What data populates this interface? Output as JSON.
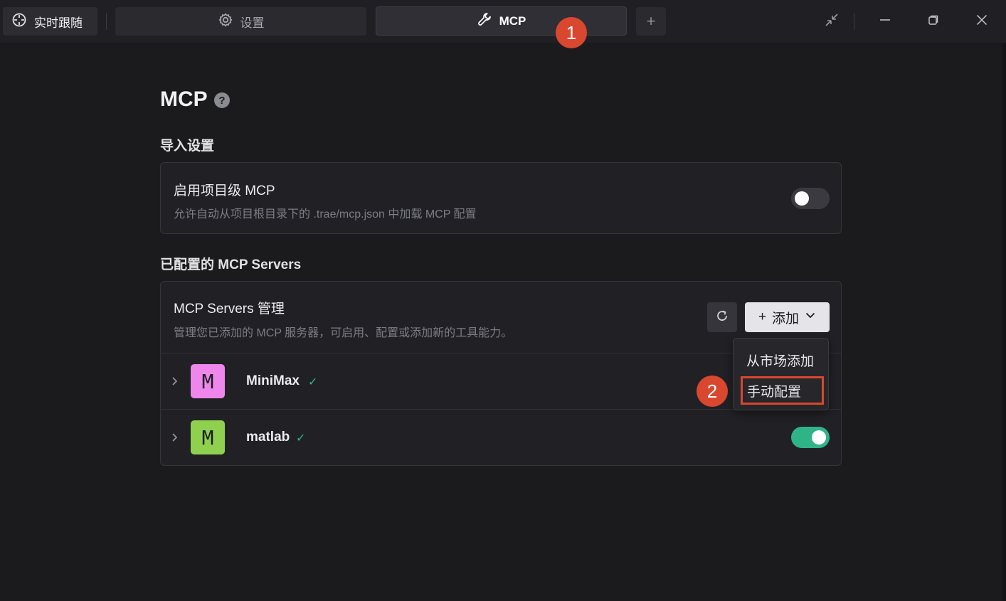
{
  "topbar": {
    "live_tab_label": "实时跟随",
    "settings_tab_label": "设置",
    "mcp_tab_label": "MCP",
    "add_tab_symbol": "+"
  },
  "annotations": {
    "step1": "1",
    "step2": "2"
  },
  "page": {
    "title": "MCP",
    "help_symbol": "?"
  },
  "import_section": {
    "heading": "导入设置",
    "card_title": "启用项目级 MCP",
    "card_desc": "允许自动从项目根目录下的 .trae/mcp.json 中加载 MCP 配置",
    "toggle_on": false
  },
  "servers_section": {
    "heading": "已配置的 MCP Servers",
    "card_title": "MCP Servers 管理",
    "card_desc": "管理您已添加的 MCP 服务器，可启用、配置或添加新的工具能力。",
    "add_button_label": "添加",
    "add_button_plus": "+",
    "servers": [
      {
        "avatar_letter": "M",
        "name": "MiniMax",
        "avatar_color": "#ef86ec",
        "status": "✓"
      },
      {
        "avatar_letter": "M",
        "name": "matlab",
        "avatar_color": "#8fd14f",
        "status": "✓",
        "enabled": true
      }
    ]
  },
  "dropdown": {
    "items": [
      "从市场添加",
      "手动配置"
    ],
    "highlighted_index": 1
  },
  "colors": {
    "accent_green": "#2fb488",
    "annotation_red": "#d9472f",
    "background": "#1b1b1e"
  },
  "icons": [
    "crosshair-icon",
    "gear-icon",
    "wrench-icon",
    "collapse-icon",
    "minimize-icon",
    "restore-icon",
    "close-icon",
    "refresh-icon",
    "chevron-down-icon",
    "chevron-right-icon",
    "check-icon",
    "help-icon"
  ]
}
